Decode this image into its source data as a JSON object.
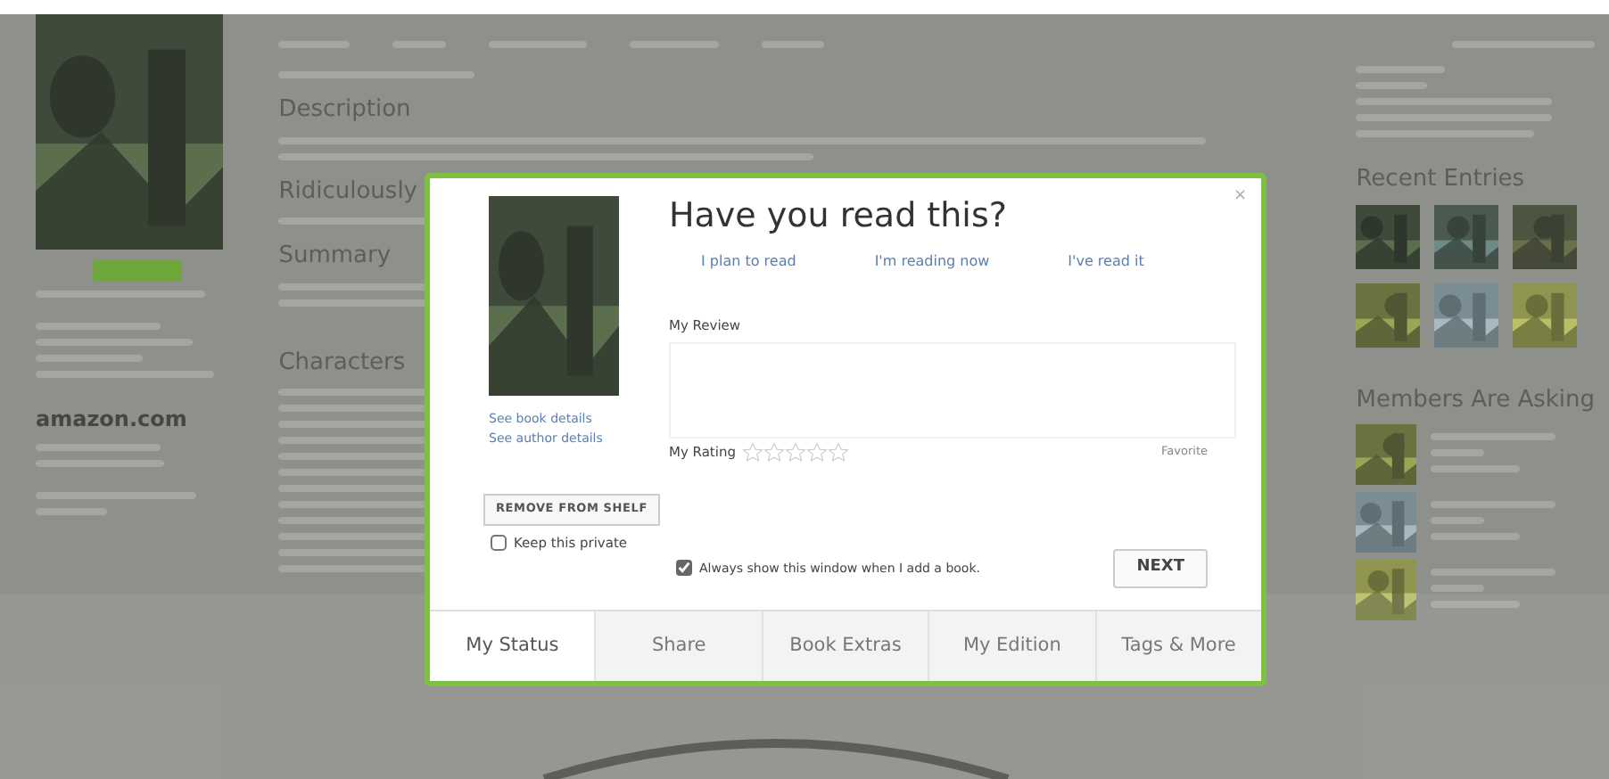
{
  "page": {
    "main_headings": [
      {
        "text": "Description"
      },
      {
        "text": "Ridiculously"
      },
      {
        "text": "Summary"
      },
      {
        "text": "Characters"
      }
    ],
    "sidebar_logo": "amazon.com",
    "right_headings": [
      "Recent Entries",
      "Members Are Asking"
    ]
  },
  "dialog": {
    "close": "×",
    "title": "Have you read this?",
    "status_links": [
      {
        "label": "I plan to read"
      },
      {
        "label": "I'm reading now"
      },
      {
        "label": "I've read it"
      }
    ],
    "review_label": "My Review",
    "book_links": [
      "See book details",
      "See author details"
    ],
    "rating_label": "My Rating",
    "stars": 0,
    "favorite": "Favorite",
    "remove_button": "REMOVE FROM SHELF",
    "private": {
      "label": "Keep this private",
      "checked": false
    },
    "always_show": {
      "label": "Always show this window when I add a book.",
      "checked": true
    },
    "next_button": "NEXT",
    "tabs": [
      {
        "label": "My Status",
        "selected": true
      },
      {
        "label": "Share",
        "selected": false
      },
      {
        "label": "Book Extras",
        "selected": false
      },
      {
        "label": "My Edition",
        "selected": false
      },
      {
        "label": "Tags & More",
        "selected": false
      }
    ]
  }
}
